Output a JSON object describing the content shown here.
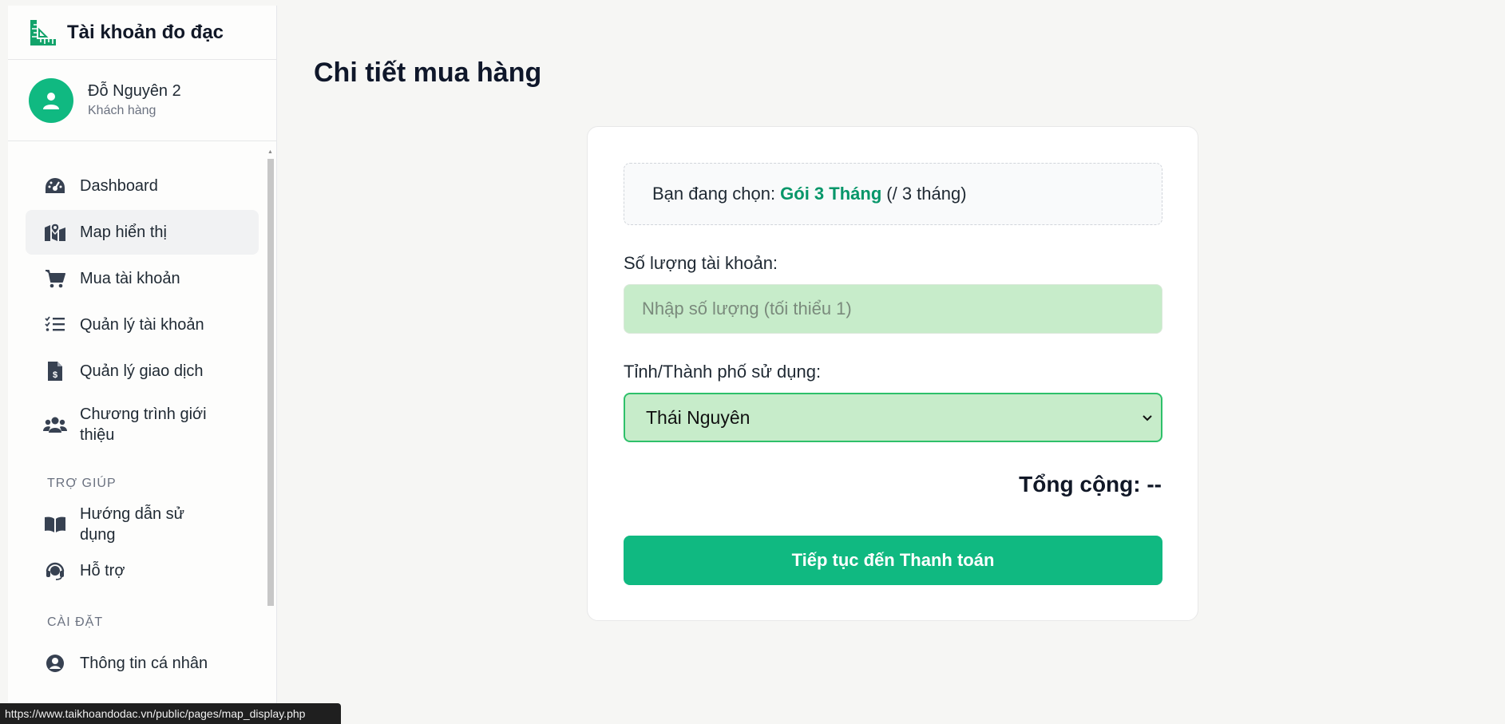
{
  "brand": {
    "name": "Tài khoản đo đạc",
    "icon": "ruler-icon"
  },
  "user": {
    "name": "Đỗ Nguyên 2",
    "role": "Khách hàng",
    "icon": "user-icon"
  },
  "nav": {
    "items": [
      {
        "label": "Dashboard",
        "icon": "gauge-icon"
      },
      {
        "label": "Map hiển thị",
        "icon": "map-pin-icon"
      },
      {
        "label": "Mua tài khoản",
        "icon": "cart-icon"
      },
      {
        "label": "Quản lý tài khoản",
        "icon": "list-check-icon"
      },
      {
        "label": "Quản lý giao dịch",
        "icon": "invoice-dollar-icon"
      },
      {
        "label": "Chương trình giới thiệu",
        "icon": "users-icon"
      }
    ],
    "help_section": "TRỢ GIÚP",
    "help_items": [
      {
        "label": "Hướng dẫn sử dụng",
        "icon": "book-icon"
      },
      {
        "label": "Hỗ trợ",
        "icon": "headset-icon"
      }
    ],
    "settings_section": "CÀI ĐẶT",
    "settings_items": [
      {
        "label": "Thông tin cá nhân",
        "icon": "user-circle-icon"
      }
    ]
  },
  "page": {
    "title": "Chi tiết mua hàng",
    "chosen_prefix": "Bạn đang chọn:",
    "chosen_package": "Gói 3 Tháng",
    "chosen_suffix": "(/ 3 tháng)",
    "quantity_label": "Số lượng tài khoản:",
    "quantity_placeholder": "Nhập số lượng (tối thiểu 1)",
    "quantity_value": "",
    "province_label": "Tỉnh/Thành phố sử dụng:",
    "province_selected": "Thái Nguyên",
    "total_label": "Tổng cộng: --",
    "continue_button": "Tiếp tục đến Thanh toán"
  },
  "statusbar": {
    "url": "https://www.taikhoandodac.vn/public/pages/map_display.php"
  },
  "colors": {
    "accent": "#10b981",
    "package": "#059669",
    "input_bg": "#c7ecca"
  }
}
